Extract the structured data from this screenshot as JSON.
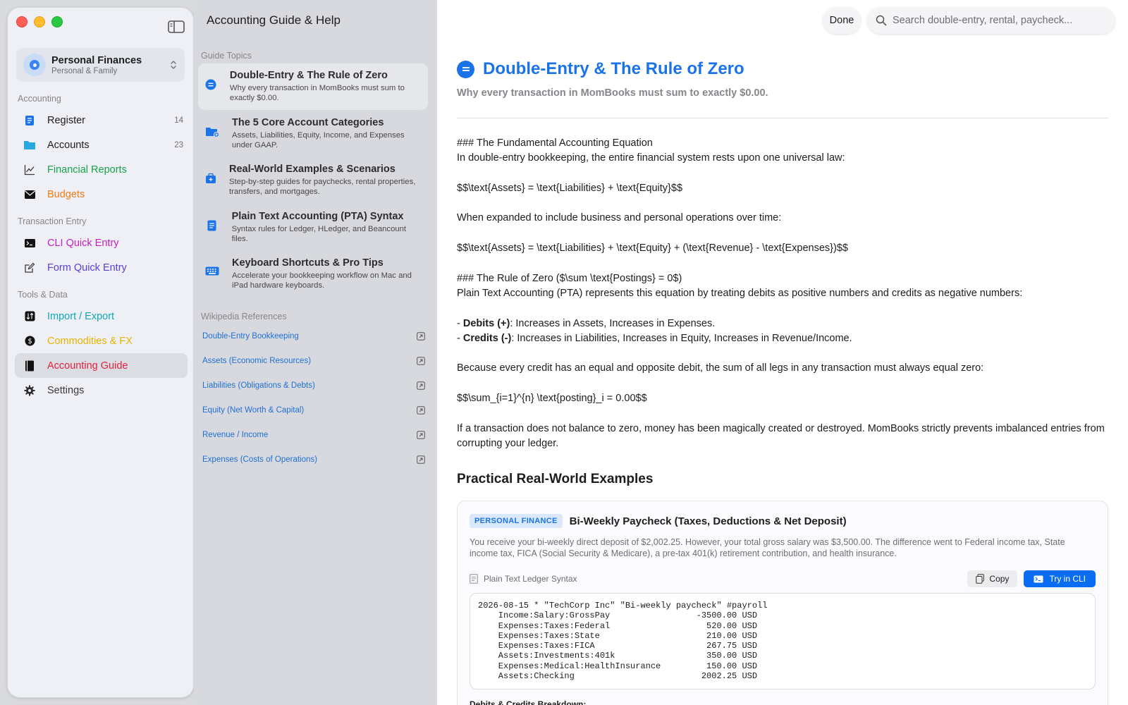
{
  "app": {
    "account_name": "Personal Finances",
    "account_sub": "Personal & Family"
  },
  "sidebar": {
    "sections": [
      {
        "heading": "Accounting",
        "items": [
          {
            "label": "Register",
            "count": "14",
            "color": "#1d1d1f",
            "icon": "register-icon"
          },
          {
            "label": "Accounts",
            "count": "23",
            "color": "#1d1d1f",
            "icon": "folder-icon"
          },
          {
            "label": "Financial Reports",
            "count": "",
            "color": "#17a34a",
            "icon": "chart-line-icon"
          },
          {
            "label": "Budgets",
            "count": "",
            "color": "#f07c12",
            "icon": "envelope-icon"
          }
        ]
      },
      {
        "heading": "Transaction Entry",
        "items": [
          {
            "label": "CLI Quick Entry",
            "count": "",
            "color": "#c21fbf",
            "icon": "terminal-icon"
          },
          {
            "label": "Form Quick Entry",
            "count": "",
            "color": "#5b3ed6",
            "icon": "compose-icon"
          }
        ]
      },
      {
        "heading": "Tools & Data",
        "items": [
          {
            "label": "Import / Export",
            "count": "",
            "color": "#0fa8b8",
            "icon": "import-export-icon"
          },
          {
            "label": "Commodities & FX",
            "count": "",
            "color": "#e5b400",
            "icon": "dollar-circle-icon"
          },
          {
            "label": "Accounting Guide",
            "count": "",
            "color": "#e0223f",
            "icon": "book-icon",
            "active": true
          },
          {
            "label": "Settings",
            "count": "",
            "color": "#3a3a3c",
            "icon": "gear-icon"
          }
        ]
      }
    ]
  },
  "topics_pane": {
    "title": "Accounting Guide & Help",
    "guide_heading": "Guide Topics",
    "topics": [
      {
        "title": "Double-Entry & The Rule of Zero",
        "sub": "Why every transaction in MomBooks must sum to exactly $0.00.",
        "icon": "equal-circle-icon"
      },
      {
        "title": "The 5 Core Account Categories",
        "sub": "Assets, Liabilities, Equity, Income, and Expenses under GAAP.",
        "icon": "folder-badge-icon"
      },
      {
        "title": "Real-World Examples & Scenarios",
        "sub": "Step-by-step guides for paychecks, rental properties, transfers, and mortgages.",
        "icon": "case-icon"
      },
      {
        "title": "Plain Text Accounting (PTA) Syntax",
        "sub": "Syntax rules for Ledger, HLedger, and Beancount files.",
        "icon": "document-icon"
      },
      {
        "title": "Keyboard Shortcuts & Pro Tips",
        "sub": "Accelerate your bookkeeping workflow on Mac and iPad hardware keyboards.",
        "icon": "keyboard-icon"
      }
    ],
    "wiki_heading": "Wikipedia References",
    "wiki_links": [
      "Double-Entry Bookkeeping",
      "Assets (Economic Resources)",
      "Liabilities (Obligations & Debts)",
      "Equity (Net Worth & Capital)",
      "Revenue / Income",
      "Expenses (Costs of Operations)"
    ]
  },
  "main": {
    "done_label": "Done",
    "search_placeholder": "Search double-entry, rental, paycheck...",
    "doc_title": "Double-Entry & The Rule of Zero",
    "doc_sub": "Why every transaction in MomBooks must sum to exactly $0.00.",
    "body": {
      "l1": "### The Fundamental Accounting Equation",
      "l2": "In double-entry bookkeeping, the entire financial system rests upon one universal law:",
      "l3": "$$\\text{Assets} = \\text{Liabilities} + \\text{Equity}$$",
      "l4": "When expanded to include business and personal operations over time:",
      "l5": "$$\\text{Assets} = \\text{Liabilities} + \\text{Equity} + (\\text{Revenue} - \\text{Expenses})$$",
      "l6": "### The Rule of Zero ($\\sum \\text{Postings} = 0$)",
      "l7": "Plain Text Accounting (PTA) represents this equation by treating debits as positive numbers and credits as negative numbers:",
      "l8_dash": "- ",
      "l8_bold": "Debits (+)",
      "l8_rest": ": Increases in Assets, Increases in Expenses.",
      "l9_dash": "- ",
      "l9_bold": "Credits (-)",
      "l9_rest": ": Increases in Liabilities, Increases in Equity, Increases in Revenue/Income.",
      "l10": "Because every credit has an equal and opposite debit, the sum of all legs in any transaction must always equal zero:",
      "l11": "$$\\sum_{i=1}^{n} \\text{posting}_i = 0.00$$",
      "l12": "If a transaction does not balance to zero, money has been magically created or destroyed. MomBooks strictly prevents imbalanced entries from corrupting your ledger."
    },
    "examples_heading": "Practical Real-World Examples",
    "example": {
      "tag": "PERSONAL FINANCE",
      "title": "Bi-Weekly Paycheck (Taxes, Deductions & Net Deposit)",
      "desc": "You receive your bi-weekly direct deposit of $2,002.25. However, your total gross salary was $3,500.00. The difference went to Federal income tax, State income tax, FICA (Social Security & Medicare), a pre-tax 401(k) retirement contribution, and health insurance.",
      "syntax_label": "Plain Text Ledger Syntax",
      "copy_label": "Copy",
      "cli_label": "Try in CLI",
      "code": "2026-08-15 * \"TechCorp Inc\" \"Bi-weekly paycheck\" #payroll\n    Income:Salary:GrossPay                 -3500.00 USD\n    Expenses:Taxes:Federal                   520.00 USD\n    Expenses:Taxes:State                     210.00 USD\n    Expenses:Taxes:FICA                      267.75 USD\n    Assets:Investments:401k                  350.00 USD\n    Expenses:Medical:HealthInsurance         150.00 USD\n    Assets:Checking                         2002.25 USD",
      "breakdown_label": "Debits & Credits Breakdown:"
    }
  }
}
